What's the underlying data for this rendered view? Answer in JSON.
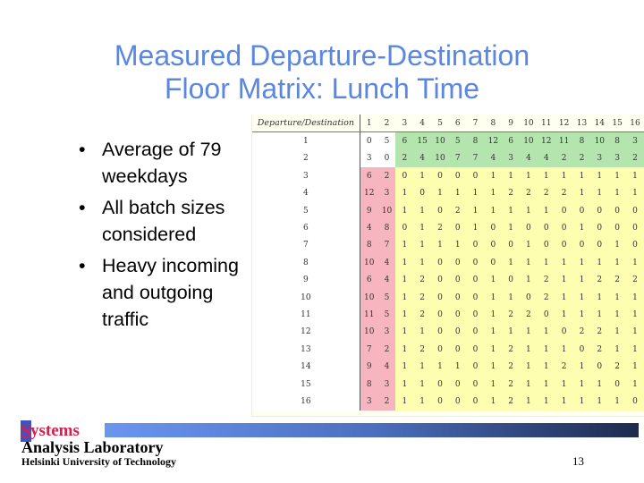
{
  "slide": {
    "title_line1": "Measured Departure-Destination",
    "title_line2": "Floor Matrix: Lunch Time",
    "bullet_glyph": "•",
    "bullets": [
      "Average of 79 weekdays",
      "All batch sizes considered",
      "Heavy incoming and outgoing traffic"
    ],
    "page_number": "13"
  },
  "logo": {
    "initial": "S",
    "rest": "ystems",
    "line2": "Analysis Laboratory",
    "line3": "Helsinki University of Technology"
  },
  "chart_data": {
    "type": "table",
    "title": "Departure/Destination floor matrix",
    "corner_label": "Departure/Destination",
    "columns": [
      "1",
      "2",
      "3",
      "4",
      "5",
      "6",
      "7",
      "8",
      "9",
      "10",
      "11",
      "12",
      "13",
      "14",
      "15",
      "16"
    ],
    "rows": [
      "1",
      "2",
      "3",
      "4",
      "5",
      "6",
      "7",
      "8",
      "9",
      "10",
      "11",
      "12",
      "13",
      "14",
      "15",
      "16"
    ],
    "highlights": {
      "green": "rows 1-2, destinations 3-16 (outgoing from entrance floors)",
      "red": "rows 3-16, destinations 1-2 (incoming to entrance floors)",
      "yellow": "rows 3-16, destinations 3-16 (inter-floor)",
      "colors": {
        "green": "#b4e5ae",
        "red": "#f7b5bf",
        "yellow": "#fefeb0"
      }
    },
    "values": [
      [
        0,
        5,
        6,
        15,
        10,
        5,
        8,
        12,
        6,
        10,
        12,
        11,
        8,
        10,
        8,
        3
      ],
      [
        3,
        0,
        2,
        4,
        10,
        7,
        7,
        4,
        3,
        4,
        4,
        2,
        2,
        3,
        3,
        2
      ],
      [
        6,
        2,
        0,
        1,
        0,
        0,
        0,
        1,
        1,
        1,
        1,
        1,
        1,
        1,
        1,
        1
      ],
      [
        12,
        3,
        1,
        0,
        1,
        1,
        1,
        1,
        2,
        2,
        2,
        2,
        1,
        1,
        1,
        1
      ],
      [
        9,
        10,
        1,
        1,
        0,
        2,
        1,
        1,
        1,
        1,
        1,
        0,
        0,
        0,
        0,
        0
      ],
      [
        4,
        8,
        0,
        1,
        2,
        0,
        1,
        0,
        1,
        0,
        0,
        0,
        1,
        0,
        0,
        0
      ],
      [
        8,
        7,
        1,
        1,
        1,
        1,
        0,
        0,
        0,
        1,
        0,
        0,
        0,
        0,
        1,
        0
      ],
      [
        10,
        4,
        1,
        1,
        0,
        0,
        0,
        0,
        1,
        1,
        1,
        1,
        1,
        1,
        1,
        1
      ],
      [
        6,
        4,
        1,
        2,
        0,
        0,
        0,
        1,
        0,
        1,
        2,
        1,
        1,
        2,
        2,
        2
      ],
      [
        10,
        5,
        1,
        2,
        0,
        0,
        0,
        1,
        1,
        0,
        2,
        1,
        1,
        1,
        1,
        1
      ],
      [
        11,
        5,
        1,
        2,
        0,
        0,
        0,
        1,
        2,
        2,
        0,
        1,
        1,
        1,
        1,
        1
      ],
      [
        10,
        3,
        1,
        1,
        0,
        0,
        0,
        1,
        1,
        1,
        1,
        0,
        2,
        2,
        1,
        1
      ],
      [
        7,
        2,
        1,
        2,
        0,
        0,
        0,
        1,
        2,
        1,
        1,
        1,
        0,
        2,
        1,
        1
      ],
      [
        9,
        4,
        1,
        1,
        1,
        1,
        0,
        1,
        2,
        1,
        1,
        2,
        1,
        0,
        2,
        1
      ],
      [
        8,
        3,
        1,
        1,
        0,
        0,
        0,
        1,
        2,
        1,
        1,
        1,
        1,
        1,
        0,
        1
      ],
      [
        3,
        2,
        1,
        1,
        0,
        0,
        0,
        1,
        2,
        1,
        1,
        1,
        1,
        1,
        1,
        0
      ]
    ]
  }
}
